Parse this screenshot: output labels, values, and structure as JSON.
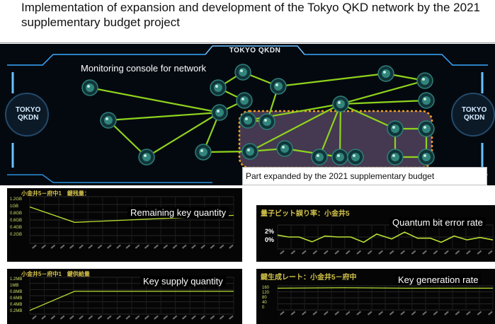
{
  "slide": {
    "title": "Implementation of expansion and development of the Tokyo QKD network by the 2021 supplementary budget project"
  },
  "console": {
    "header": "TOKYO QKDN",
    "logo_left": "TOKYO\nQKDN",
    "logo_right": "TOKYO\nQKDN",
    "monitor_label": "Monitoring console for network",
    "expanded_label": "Part expanded by the 2021 supplementary budget"
  },
  "panels": {
    "remaining": {
      "header": "小金井5－府中1　鍵残量：",
      "label": "Remaining key quantity",
      "yticks": [
        "1.2GB",
        "1GB",
        "0.8GB",
        "0.6GB",
        "0.4GB",
        "0.2GB"
      ]
    },
    "qber": {
      "header": "量子ビット誤り率：小金井5",
      "label": "Quantum bit error rate",
      "yticks": [
        "2%",
        "0%"
      ]
    },
    "supply": {
      "header": "小金井5－府中1　鍵供給量",
      "label": "Key supply quantity",
      "yticks": [
        "1.2MB",
        "1MB",
        "0.8MB",
        "0.6MB",
        "0.4MB",
        "0.2MB"
      ]
    },
    "rate": {
      "header": "鍵生成レート：小金井5－府中",
      "label": "Key generation rate",
      "yticks": [
        "160",
        "120",
        "80",
        "40",
        "0"
      ]
    }
  },
  "colors": {
    "link": "#8fd31c",
    "node": "#3a9a8c",
    "frame": "#2a8fd8",
    "highlight_border": "#f0a020",
    "highlight_fill": "#5a4a66",
    "chart_line": "#b8e034",
    "grid": "#2a2a2a"
  }
}
